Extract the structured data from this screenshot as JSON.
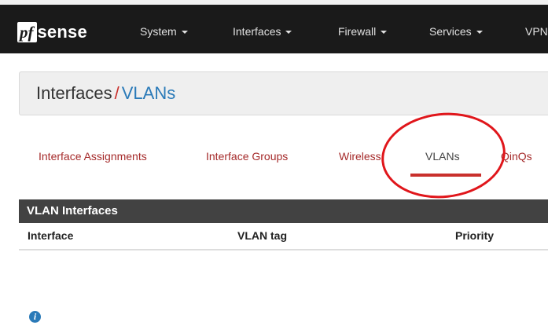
{
  "brand": {
    "logo_pf": "pf",
    "logo_sense": "sense"
  },
  "nav": {
    "items": [
      {
        "label": "System",
        "has_dropdown": true
      },
      {
        "label": "Interfaces",
        "has_dropdown": true
      },
      {
        "label": "Firewall",
        "has_dropdown": true
      },
      {
        "label": "Services",
        "has_dropdown": true
      },
      {
        "label": "VPN",
        "has_dropdown": false
      }
    ]
  },
  "breadcrumb": {
    "section": "Interfaces",
    "separator": "/",
    "page": "VLANs"
  },
  "tabs": [
    {
      "label": "Interface Assignments",
      "active": false
    },
    {
      "label": "Interface Groups",
      "active": false
    },
    {
      "label": "Wireless",
      "active": false
    },
    {
      "label": "VLANs",
      "active": true
    },
    {
      "label": "QinQs",
      "active": false
    }
  ],
  "panel": {
    "title": "VLAN Interfaces",
    "columns": [
      "Interface",
      "VLAN tag",
      "Priority"
    ]
  },
  "icons": {
    "info": "info-icon"
  },
  "colors": {
    "navbar": "#1a1a1a",
    "tab_text": "#a52a2a",
    "active_underline": "#c9302c",
    "breadcrumb_link": "#2a7ab8",
    "panel_header": "#424242",
    "annotation": "#e0161b"
  }
}
